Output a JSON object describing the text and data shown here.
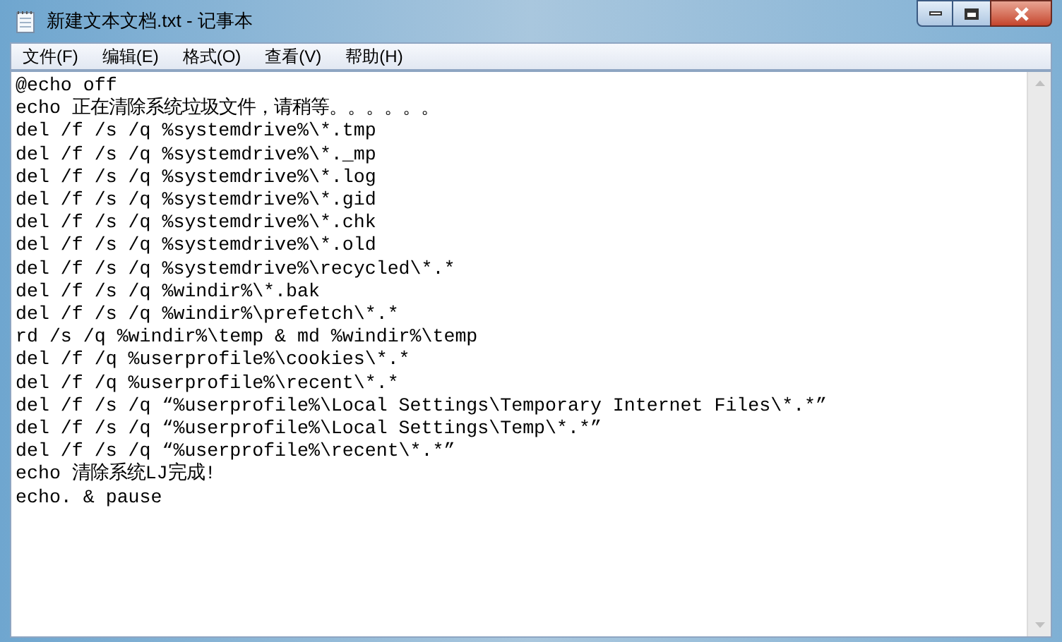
{
  "window": {
    "title": "新建文本文档.txt - 记事本"
  },
  "menu": [
    "文件(F)",
    "编辑(E)",
    "格式(O)",
    "查看(V)",
    "帮助(H)"
  ],
  "lines": [
    "@echo off",
    "echo 正在清除系统垃圾文件，请稍等。。。。。。",
    "del /f /s /q %systemdrive%\\*.tmp",
    "del /f /s /q %systemdrive%\\*._mp",
    "del /f /s /q %systemdrive%\\*.log",
    "del /f /s /q %systemdrive%\\*.gid",
    "del /f /s /q %systemdrive%\\*.chk",
    "del /f /s /q %systemdrive%\\*.old",
    "del /f /s /q %systemdrive%\\recycled\\*.*",
    "del /f /s /q %windir%\\*.bak",
    "del /f /s /q %windir%\\prefetch\\*.*",
    "rd /s /q %windir%\\temp & md %windir%\\temp",
    "del /f /q %userprofile%\\cookies\\*.*",
    "del /f /q %userprofile%\\recent\\*.*",
    "del /f /s /q “%userprofile%\\Local Settings\\Temporary Internet Files\\*.*”",
    "del /f /s /q “%userprofile%\\Local Settings\\Temp\\*.*”",
    "del /f /s /q “%userprofile%\\recent\\*.*”",
    "echo 清除系统LJ完成!",
    "echo. & pause"
  ]
}
